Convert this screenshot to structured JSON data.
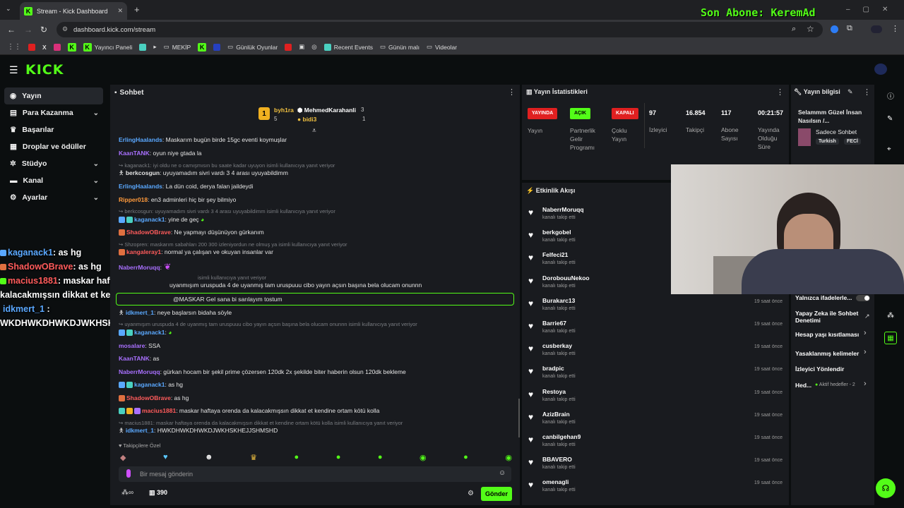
{
  "browser": {
    "tab_title": "Stream - Kick Dashboard",
    "url": "dashboard.kick.com/stream",
    "bookmarks": [
      "Yayıncı Paneli",
      "MEKİP",
      "Günlük Oyunlar",
      "Recent Events",
      "Günün malı",
      "Videolar"
    ]
  },
  "overlay_top": "Son Abone: KeremAd",
  "sidebar": {
    "items": [
      {
        "label": "Yayın",
        "icon": "broadcast-icon",
        "active": true
      },
      {
        "label": "Para Kazanma",
        "icon": "money-icon",
        "chevron": true
      },
      {
        "label": "Başarılar",
        "icon": "trophy-icon"
      },
      {
        "label": "Droplar ve ödüller",
        "icon": "gift-icon"
      },
      {
        "label": "Stüdyo",
        "icon": "gear-icon",
        "chevron": true
      },
      {
        "label": "Kanal",
        "icon": "tv-icon",
        "chevron": true
      },
      {
        "label": "Ayarlar",
        "icon": "settings-icon",
        "chevron": true
      }
    ]
  },
  "stream_overlay": [
    {
      "user": "kaganack1",
      "text": ": as hg",
      "color": "#5aa8ff"
    },
    {
      "user": "ShadowOBrave",
      "text": ": as hg",
      "color": "#ff5b5b"
    },
    {
      "user": "macius1881",
      "text": ": maskar haftaya orenda da",
      "color": "#ff5b5b"
    },
    {
      "user": "",
      "text": "kalacakmışsın dikkat et kendine ortam kötü kolla",
      "color": "#fff"
    },
    {
      "user": "idkmert_1",
      "text": " :",
      "color": "#5aa8ff"
    },
    {
      "user": "",
      "text": "WKDHWKDHWKDJWKHSKHEJJSHMSHD",
      "color": "#fff"
    }
  ],
  "chat": {
    "title": "Sohbet",
    "top_gifters": [
      {
        "name": "byh1ra",
        "count": "5"
      },
      {
        "name": "MehmedKarahanli",
        "count": "3"
      },
      {
        "name": "bidi3",
        "count": "1"
      }
    ],
    "messages": [
      {
        "user": "ErlingHaalands",
        "color": "#5aa8ff",
        "text": ": Maskarım bugün birde 15gc eventi koymuşlar"
      },
      {
        "user": "KaanTANK",
        "color": "#a970ff",
        "text": ": oyun niye gtada la"
      },
      {
        "reply": "kaganack1: iyi oldu ne o camışmısın bu saate kadar uyuyon isimli kullanıcıya yanıt veriyor"
      },
      {
        "user": "berkcosgun",
        "color": "#e8e8e8",
        "text": ": uyuyamadım sivri vardı 3 4 arası uyuyabildimm"
      },
      {
        "user": "ErlingHaalands",
        "color": "#5aa8ff",
        "text": ": La dün coid, derya falan jaildeydi"
      },
      {
        "user": "Ripper018",
        "color": "#ff9a3c",
        "text": ": en3 adminleri hiç bir şey bilmiyo"
      },
      {
        "reply": "berkcosgun: uyuyamadım sivri vardı 3 4 arası uyuyabildimm isimli kullanıcıya yanıt veriyor"
      },
      {
        "user": "kaganack1",
        "color": "#5aa8ff",
        "text": ": yine de geç"
      },
      {
        "user": "ShadowOBrave",
        "color": "#ff5b5b",
        "text": ": Ne yapmayı düşünüyon gürkanım"
      },
      {
        "reply": "Shzopren: maskarım sabahları 200 300 izleniyordun ne olmuş ya isimli kullanıcıya yanıt veriyor"
      },
      {
        "user": "kangaleray1",
        "color": "#ff5b5b",
        "text": ": normal ya çalışan ve okuyan insanlar var"
      },
      {
        "user": "NaberrMoruqq",
        "color": "#a970ff",
        "text": ":"
      },
      {
        "reply": "isimli kullanıcıya yanıt veriyor"
      },
      {
        "user": "",
        "color": "#e8e8e8",
        "text": "uyanmışım uruspuda 4 de uyanmış tam uruspuuu cibo yayın açsın başına bela olucam onunnn"
      },
      {
        "user": "",
        "color": "#e8e8e8",
        "text": "@MASKAR Gel sana bi sarılayım tostum"
      },
      {
        "user": "idkmert_1",
        "color": "#5aa8ff",
        "text": ": neye başlarsın bidaha söyle"
      },
      {
        "reply": "uyanmışım uruspuda 4 de uyanmış tam uruspuuu cibo yayın açsın başına bela olucam onunnn isimli kullanıcıya yanıt veriyor"
      },
      {
        "user": "kaganack1",
        "color": "#5aa8ff",
        "text": ":"
      },
      {
        "user": "mosalare",
        "color": "#a970ff",
        "text": ": SSA"
      },
      {
        "user": "KaanTANK",
        "color": "#a970ff",
        "text": ": as"
      },
      {
        "user": "NaberrMoruqq",
        "color": "#a970ff",
        "text": ": gürkan hocam bir şekil prime çözersen 120dk 2x şekilde biter haberin olsun 120dk bekleme"
      },
      {
        "user": "kaganack1",
        "color": "#5aa8ff",
        "text": ": as hg"
      },
      {
        "user": "ShadowOBrave",
        "color": "#ff5b5b",
        "text": ": as hg"
      },
      {
        "user": "macius1881",
        "color": "#ff5b5b",
        "text": ": maskar haftaya orenda da kalacakmışsın dikkat et kendine ortam kötü kolla"
      },
      {
        "reply": "macius1881: maskar haftaya orenda da kalacakmışsın dikkat et kendine ortam kötü kolla isimli kullanıcıya yanıt veriyor"
      },
      {
        "user": "idkmert_1",
        "color": "#5aa8ff",
        "text": ": HWKDHWKDHWKDJWKHSKHEJJSHMSHD"
      }
    ],
    "follower_only_label": "Takipçilere Özel",
    "input_placeholder": "Bir mesaj gönderin",
    "points": "390",
    "send_label": "Gönder"
  },
  "stats": {
    "title": "Yayın İstatistikleri",
    "items": [
      {
        "badge": "YAYINDA",
        "badge_color": "#e02020",
        "label": "Yayın"
      },
      {
        "badge": "AÇIK",
        "badge_color": "#53fc18",
        "label": "Partnerlik Gelir Programı"
      },
      {
        "badge": "KAPALI",
        "badge_color": "#e02020",
        "label": "Çoklu Yayın"
      },
      {
        "value": "97",
        "label": "İzleyici"
      },
      {
        "value": "16.854",
        "label": "Takipçi"
      },
      {
        "value": "117",
        "label": "Abone Sayısı"
      },
      {
        "value": "00:21:57",
        "label": "Yayında Olduğu Süre"
      }
    ]
  },
  "events": {
    "title": "Etkinlik Akışı",
    "sub": "kanalı takip etti",
    "items": [
      {
        "name": "NaberrMoruqq",
        "time": ""
      },
      {
        "name": "berkgobel",
        "time": ""
      },
      {
        "name": "Felfeci21",
        "time": ""
      },
      {
        "name": "DorobouuNekoo",
        "time": ""
      },
      {
        "name": "Burakarc13",
        "time": "19 saat önce"
      },
      {
        "name": "Barrie67",
        "time": "19 saat önce"
      },
      {
        "name": "cusberkay",
        "time": "19 saat önce"
      },
      {
        "name": "bradpic",
        "time": "19 saat önce"
      },
      {
        "name": "Restoya",
        "time": "19 saat önce"
      },
      {
        "name": "AzizBrain",
        "time": "19 saat önce"
      },
      {
        "name": "canbilgehan9",
        "time": "19 saat önce"
      },
      {
        "name": "BBAVERO",
        "time": "19 saat önce"
      },
      {
        "name": "omenagli",
        "time": "19 saat önce"
      }
    ]
  },
  "info": {
    "title": "Yayın bilgisi",
    "stream_title": "Selammm Güzel İnsan Nasılsın /...",
    "category": "Sadece Sohbet",
    "tags": [
      "Turkish",
      "FECİ"
    ],
    "links": [
      {
        "label": "Yalnızca ifadelerle..."
      },
      {
        "label": "Yapay Zeka ile Sohbet Denetimi"
      },
      {
        "label": "Hesap yaşı kısıtlaması"
      },
      {
        "label": "Yasaklanmış kelimeler"
      },
      {
        "label": "İzleyici Yönlendir"
      },
      {
        "label": "Hed..."
      }
    ],
    "goals_label": "Aktif hedefler - 2"
  }
}
